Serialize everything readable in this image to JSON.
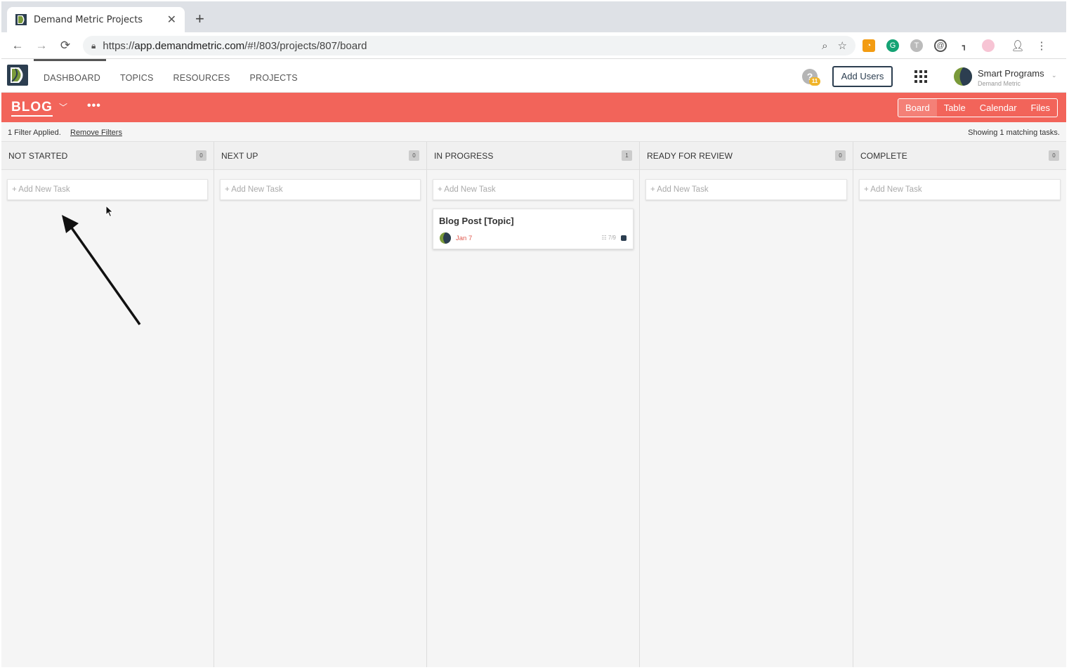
{
  "browser": {
    "tab_title": "Demand Metric Projects",
    "url_prefix": "https://",
    "url_host": "app.demandmetric.com",
    "url_path": "/#!/803/projects/807/board"
  },
  "app": {
    "nav": [
      "DASHBOARD",
      "TOPICS",
      "RESOURCES",
      "PROJECTS"
    ],
    "help_icon": "?",
    "help_badge": "11",
    "add_users_label": "Add Users",
    "user_name": "Smart Programs",
    "user_org": "Demand Metric"
  },
  "project": {
    "title": "BLOG",
    "more": "•••",
    "views": [
      "Board",
      "Table",
      "Calendar",
      "Files"
    ],
    "active_view": "Board"
  },
  "filter": {
    "applied_text": "1 Filter Applied.",
    "remove_label": "Remove Filters",
    "showing_text": "Showing 1 matching tasks."
  },
  "board": {
    "add_task_placeholder": "+ Add New Task",
    "columns": [
      {
        "name": "NOT STARTED",
        "count": "0"
      },
      {
        "name": "NEXT UP",
        "count": "0"
      },
      {
        "name": "IN PROGRESS",
        "count": "1"
      },
      {
        "name": "READY FOR REVIEW",
        "count": "0"
      },
      {
        "name": "COMPLETE",
        "count": "0"
      }
    ],
    "task": {
      "title": "Blog Post [Topic]",
      "date": "Jan 7",
      "checklist": "☷ 7/9"
    }
  },
  "colors": {
    "project_bar": "#f2645a",
    "brand_navy": "#2c3e50",
    "due_date": "#e05a4f"
  }
}
